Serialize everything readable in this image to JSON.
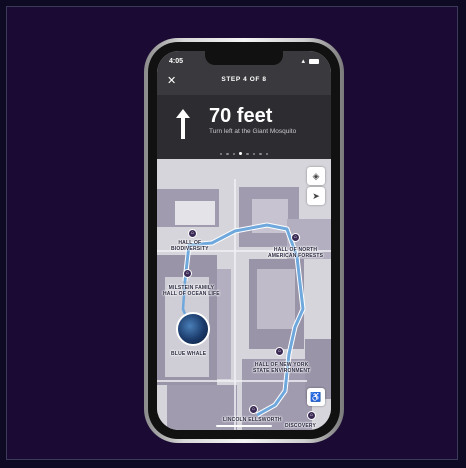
{
  "status": {
    "time": "4:05",
    "location_arrow": "location-arrow-icon"
  },
  "nav": {
    "close_icon": "close-icon",
    "step": "STEP 4 OF 8",
    "distance": "70 feet",
    "instruction": "Turn left at the Giant Mosquito",
    "arrow_icon": "arrow-up-icon",
    "dots_total": 8,
    "dots_active_index": 3
  },
  "map": {
    "labels": {
      "biodiversity": [
        "HALL OF",
        "BIODIVERSITY"
      ],
      "north_american_forests": [
        "HALL OF NORTH",
        "AMERICAN FORESTS"
      ],
      "ocean_life": [
        "MILSTEIN FAMILY",
        "HALL OF OCEAN LIFE"
      ],
      "blue_whale": "BLUE WHALE",
      "ny_environment": [
        "HALL OF NEW YORK",
        "STATE ENVIRONMENT"
      ],
      "lincoln_ellsworth": "LINCOLN ELLSWORTH",
      "discovery": "DISCOVERY"
    },
    "controls": [
      "layers-icon",
      "locate-arrow-icon",
      "accessibility-icon"
    ]
  },
  "colors": {
    "background": "#1b0a33",
    "header": "#3a3a3e",
    "route": "#6fa8dc",
    "walls": "#9a94a8",
    "floor": "#d6d5db"
  }
}
